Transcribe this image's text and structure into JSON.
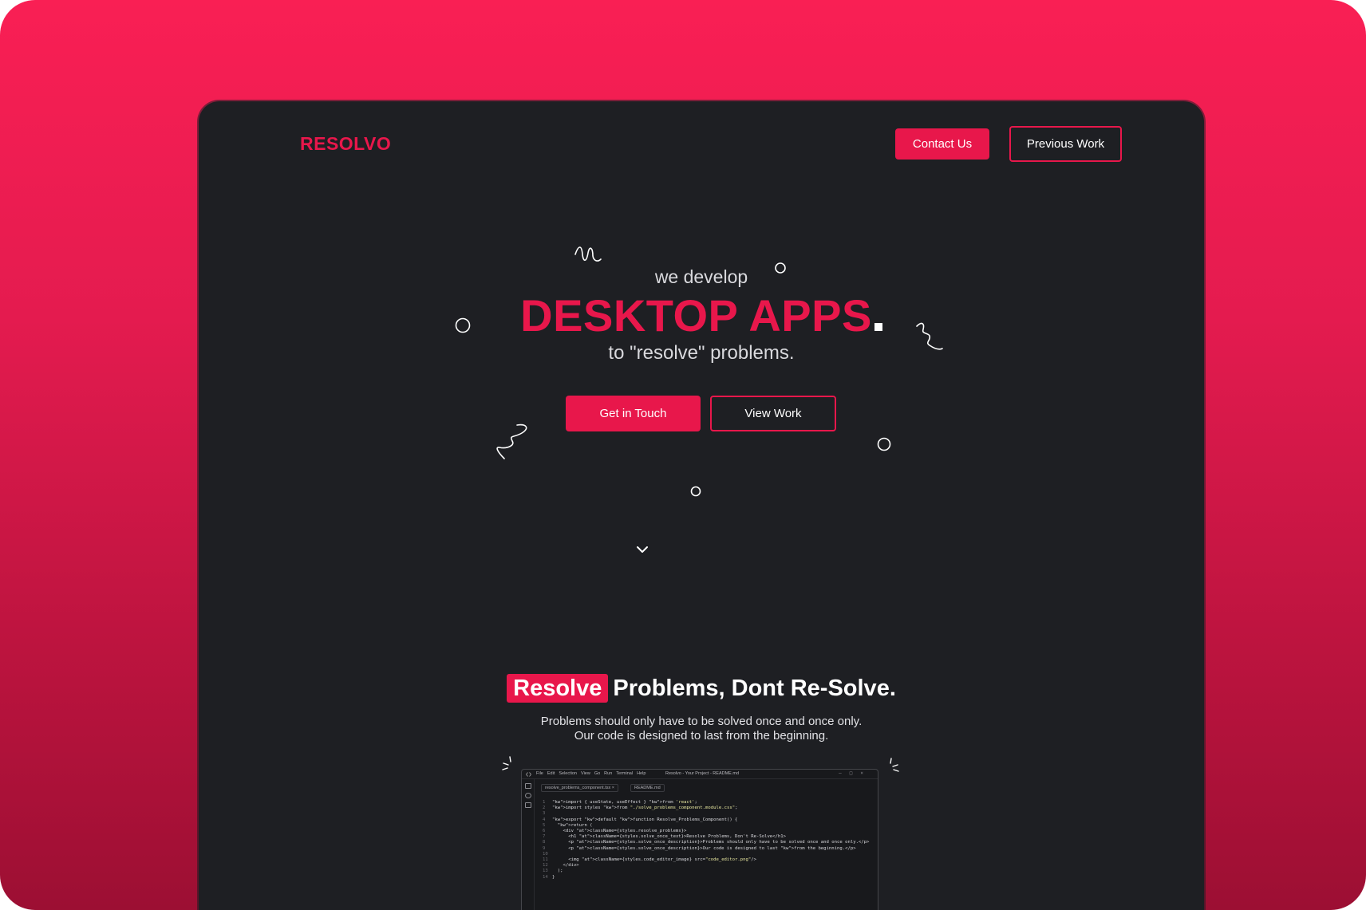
{
  "colors": {
    "accent": "#e8174b",
    "background": "#1e1f23",
    "frame_gradient_top": "#f91f54",
    "frame_gradient_bottom": "#9c0f33"
  },
  "nav": {
    "logo": "RESOLVO",
    "contact_label": "Contact Us",
    "previous_work_label": "Previous Work"
  },
  "hero": {
    "pretitle": "we develop",
    "title": "DESKTOP APPS",
    "subtitle": "to \"resolve\" problems.",
    "primary_button": "Get in Touch",
    "secondary_button": "View Work",
    "scroll_icon": "chevron-down-icon"
  },
  "section": {
    "highlight": "Resolve",
    "title_rest": "Problems, Dont Re-Solve.",
    "desc_line1": "Problems should only have to be solved once and once only.",
    "desc_line2": "Our code is designed to last from the beginning."
  },
  "editor": {
    "menu": [
      "File",
      "Edit",
      "Selection",
      "View",
      "Go",
      "Run",
      "Terminal",
      "Help"
    ],
    "window_title": "Resolvo - Your Project - README.md",
    "tabs": [
      "resolve_problems_component.tsx",
      "README.md"
    ],
    "code_lines": [
      "import { useState, useEffect } from 'react';",
      "import styles from \"./solve_problems_component.module.css\";",
      "",
      "export default function Resolve_Problems_Component() {",
      "  return (",
      "    <div className={styles.resolve_problems}>",
      "      <h1 className={styles.solve_once_text}>Resolve Problems, Don't Re-Solve</h1>",
      "      <p className={styles.solve_once_description}>Problems should only have to be solved once and once only.</p>",
      "      <p className={styles.solve_once_description}>Our code is designed to last from the beginning.</p>",
      "",
      "      <img className={styles.code_editor_image} src=\"code_editor.png\"/>",
      "    </div>",
      "  );",
      "}"
    ]
  }
}
